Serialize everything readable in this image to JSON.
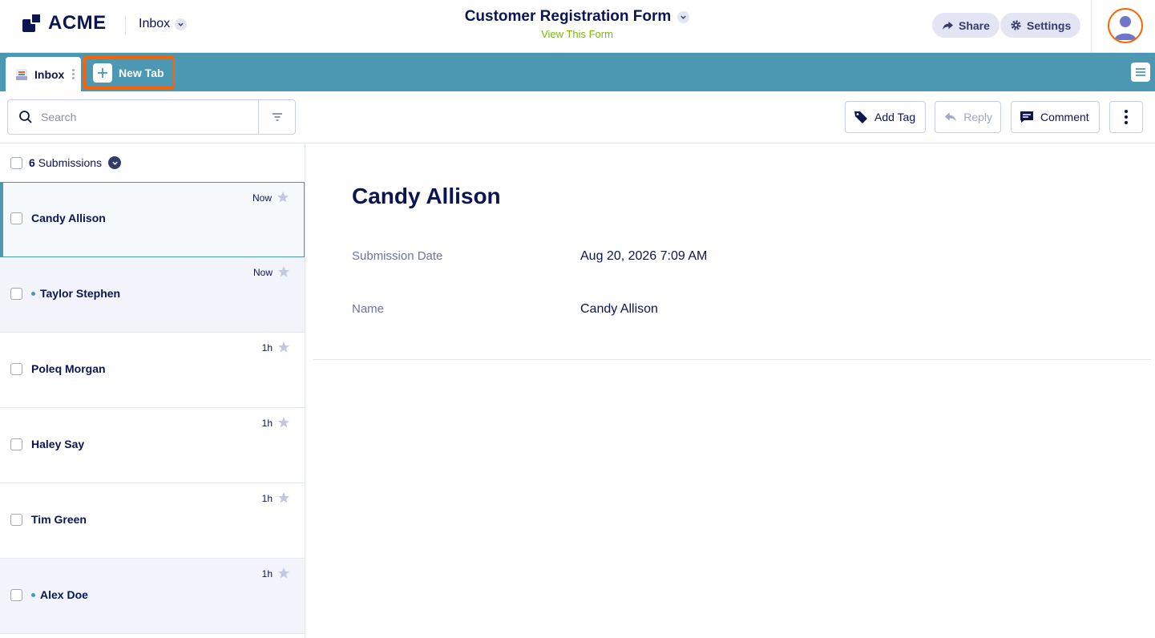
{
  "header": {
    "logo_text": "ACME",
    "inbox_label": "Inbox",
    "form_title": "Customer Registration Form",
    "form_subtitle": "View This Form",
    "share_label": "Share",
    "settings_label": "Settings"
  },
  "tabs": {
    "inbox_tab_label": "Inbox",
    "new_tab_label": "New Tab"
  },
  "toolbar": {
    "search_placeholder": "Search",
    "add_tag_label": "Add Tag",
    "reply_label": "Reply",
    "comment_label": "Comment"
  },
  "list": {
    "count": "6",
    "count_label": "Submissions",
    "items": [
      {
        "name": "Candy Allison",
        "time": "Now"
      },
      {
        "name": "Taylor Stephen",
        "time": "Now"
      },
      {
        "name": "Poleq Morgan",
        "time": "1h"
      },
      {
        "name": "Haley Say",
        "time": "1h"
      },
      {
        "name": "Tim Green",
        "time": "1h"
      },
      {
        "name": "Alex Doe",
        "time": "1h"
      }
    ]
  },
  "detail": {
    "name": "Candy Allison",
    "fields": [
      {
        "label": "Submission Date",
        "value": "Aug 20, 2026 7:09 AM"
      },
      {
        "label": "Name",
        "value": "Candy Allison"
      }
    ]
  },
  "colors": {
    "accent": "#4c98b3",
    "highlight": "#ff6100",
    "navy": "#0a1551",
    "link_green": "#78bb07"
  }
}
